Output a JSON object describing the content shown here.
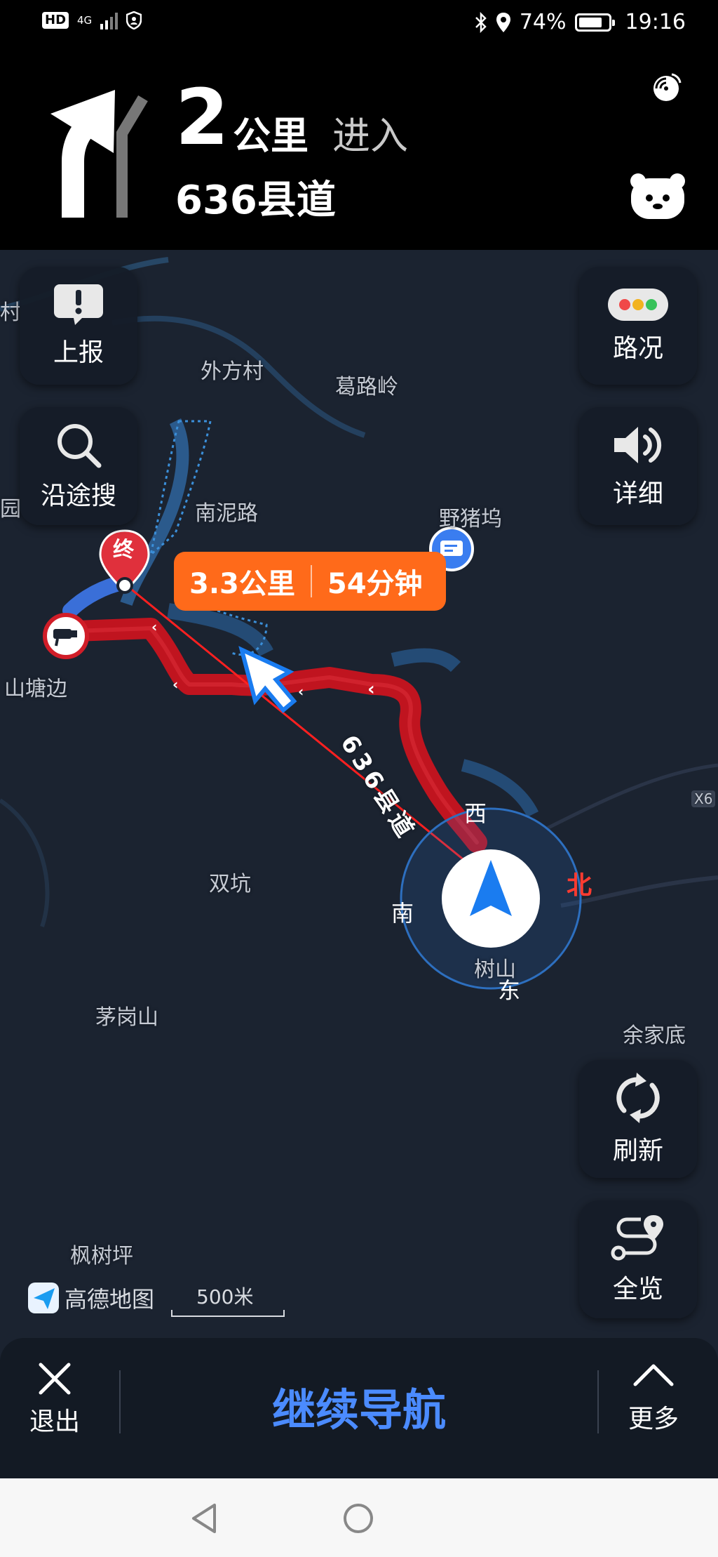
{
  "status_bar": {
    "hd": "HD",
    "network": "4G",
    "battery": "74%",
    "time": "19:16"
  },
  "navigation": {
    "distance_value": "2",
    "distance_unit": "公里",
    "action": "进入",
    "road_name": "636县道"
  },
  "map": {
    "places": {
      "waifangcun": "外方村",
      "gelulin": "葛路岭",
      "nannilu": "南泥路",
      "yezhuwu": "野猪坞",
      "shantangbian": "山塘边",
      "shuangkeng": "双坑",
      "maogangshan": "茅岗山",
      "shushan": "树山",
      "yujiadi": "余家底",
      "fengshuping": "枫树坪",
      "edge_cun": "村",
      "edge_yuan": "园",
      "edge_x": "X6"
    },
    "road_label": "636县道",
    "destination_marker": "终",
    "eta_distance": "3.3公里",
    "eta_time": "54分钟",
    "compass": {
      "north": "北",
      "south": "南",
      "east": "东",
      "west": "西"
    },
    "brand": "高德地图",
    "scale": "500米"
  },
  "buttons": {
    "report": "上报",
    "traffic": "路况",
    "search_along": "沿途搜",
    "detail": "详细",
    "refresh": "刷新",
    "overview": "全览"
  },
  "bottom_bar": {
    "exit": "退出",
    "continue_navigation": "继续导航",
    "more": "更多"
  },
  "colors": {
    "route": "#c0141f",
    "eta_bubble": "#ff6a1a",
    "continue_text": "#4b8bff",
    "map_background": "#1b2330"
  }
}
